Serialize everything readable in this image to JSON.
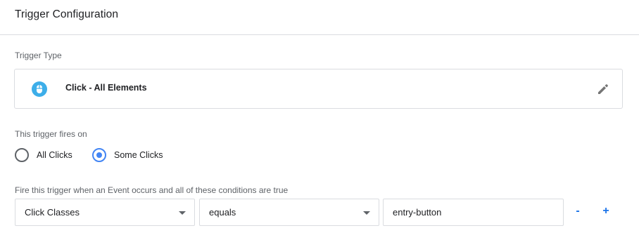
{
  "header": {
    "title": "Trigger Configuration"
  },
  "trigger_type": {
    "label": "Trigger Type",
    "name": "Click - All Elements",
    "icon": "mouse-icon",
    "icon_color": "#3daee9"
  },
  "fires_on": {
    "label": "This trigger fires on",
    "options": [
      {
        "label": "All Clicks",
        "checked": false
      },
      {
        "label": "Some Clicks",
        "checked": true
      }
    ]
  },
  "conditions": {
    "label": "Fire this trigger when an Event occurs and all of these conditions are true",
    "variable": "Click Classes",
    "operator": "equals",
    "value": "entry-button",
    "remove_label": "-",
    "add_label": "+"
  },
  "colors": {
    "accent": "#4285f4",
    "link": "#1a73e8",
    "border": "#dadce0"
  }
}
